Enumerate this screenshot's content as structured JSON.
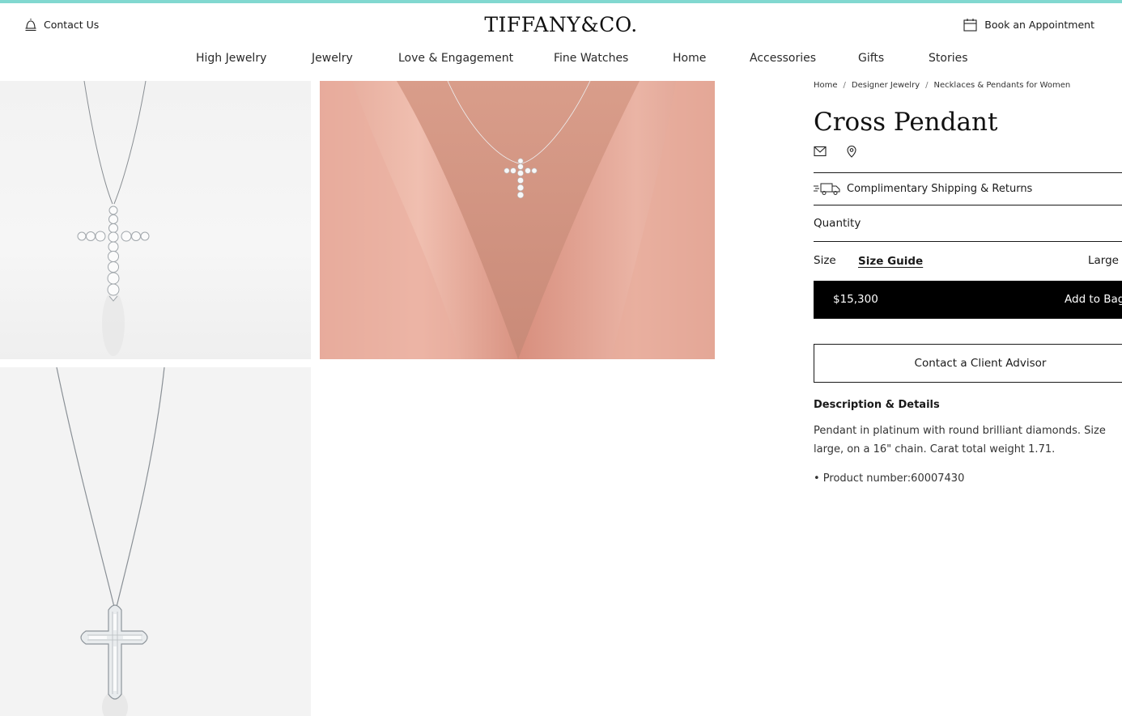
{
  "header": {
    "contact_label": "Contact Us",
    "logo_text": "TIFFANY&CO.",
    "appointment_label": "Book an Appointment"
  },
  "nav": {
    "items": [
      "High Jewelry",
      "Jewelry",
      "Love & Engagement",
      "Fine Watches",
      "Home",
      "Accessories",
      "Gifts",
      "Stories"
    ]
  },
  "breadcrumb": {
    "items": [
      "Home",
      "Designer Jewelry",
      "Necklaces & Pendants for Women"
    ],
    "separator": "/"
  },
  "product": {
    "title": "Cross Pendant",
    "shipping_label": "Complimentary Shipping & Returns",
    "quantity_label": "Quantity",
    "size_label": "Size",
    "size_guide_label": "Size Guide",
    "size_value": "Large",
    "price": "$15,300",
    "add_to_bag_label": "Add to Bag",
    "advisor_label": "Contact a Client Advisor",
    "description_heading": "Description & Details",
    "description": "Pendant in platinum with round brilliant diamonds. Size large, on a 16\" chain. Carat total weight 1.71.",
    "product_number": "• Product number:60007430"
  },
  "colors": {
    "accent": "#81d8d0",
    "button_bg": "#000000",
    "model_backdrop": "#e7b3a3"
  },
  "icons": [
    "bell-icon",
    "calendar-icon",
    "email-icon",
    "pin-icon",
    "truck-icon"
  ]
}
